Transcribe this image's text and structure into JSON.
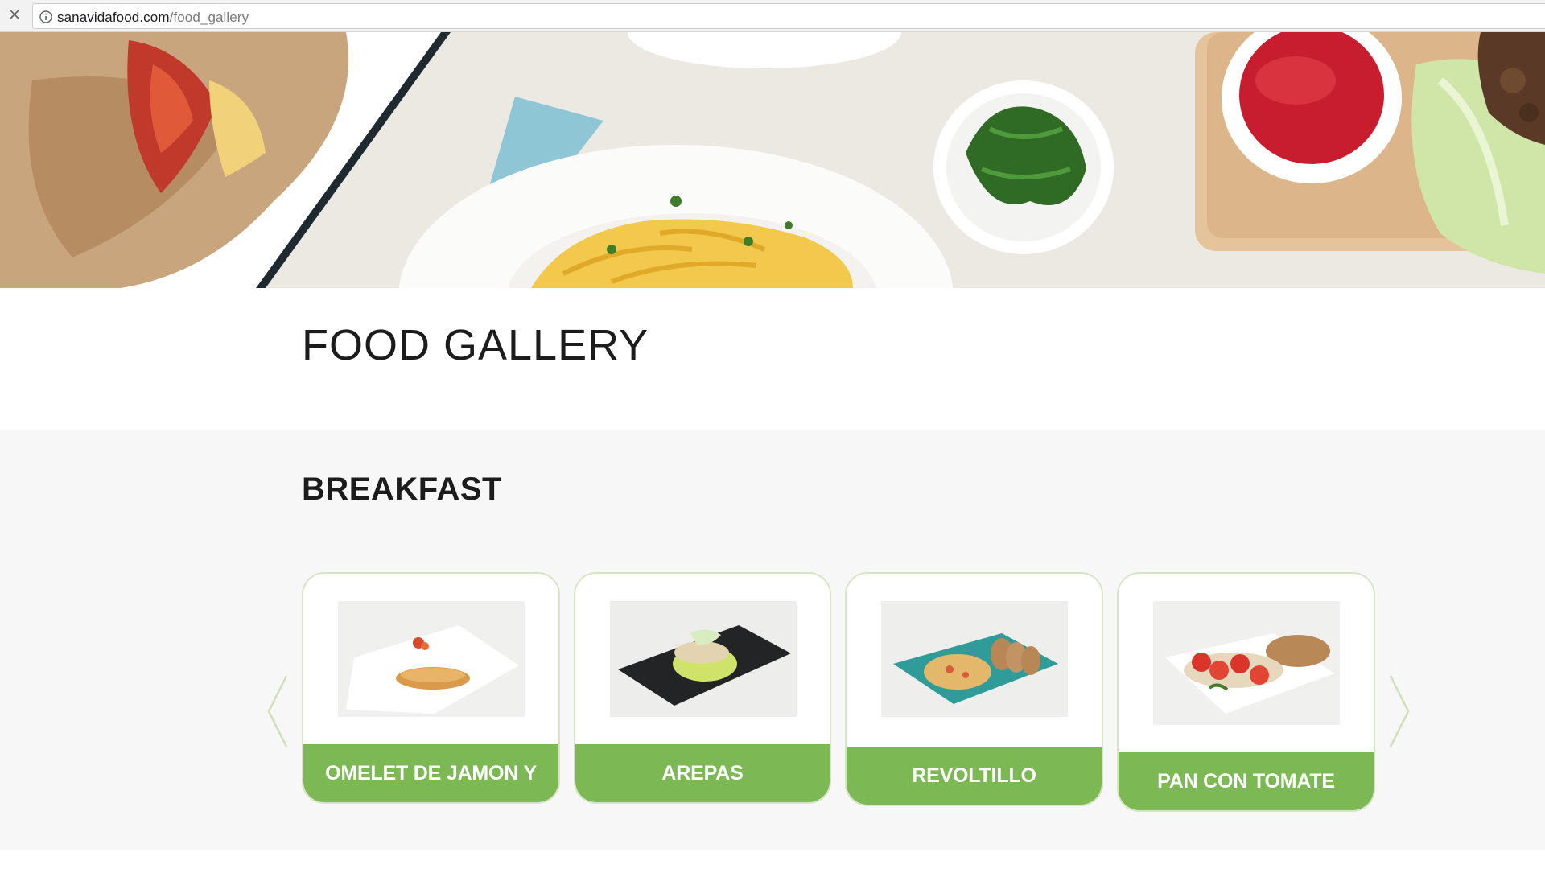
{
  "browser": {
    "url_domain": "sanavidafood.com",
    "url_path": "/food_gallery"
  },
  "page": {
    "title": "FOOD GALLERY"
  },
  "breakfast": {
    "title": "BREAKFAST",
    "items": [
      {
        "label": "OMELET DE JAMON Y"
      },
      {
        "label": "AREPAS"
      },
      {
        "label": "REVOLTILLO"
      },
      {
        "label": "PAN CON TOMATE"
      }
    ]
  },
  "colors": {
    "label_green": "#7cb955",
    "card_border": "#d9e4c6",
    "section_bg": "#f7f7f7"
  },
  "icons": {
    "close": "close-icon",
    "info": "info-icon",
    "prev": "chevron-left-icon",
    "next": "chevron-right-icon"
  }
}
